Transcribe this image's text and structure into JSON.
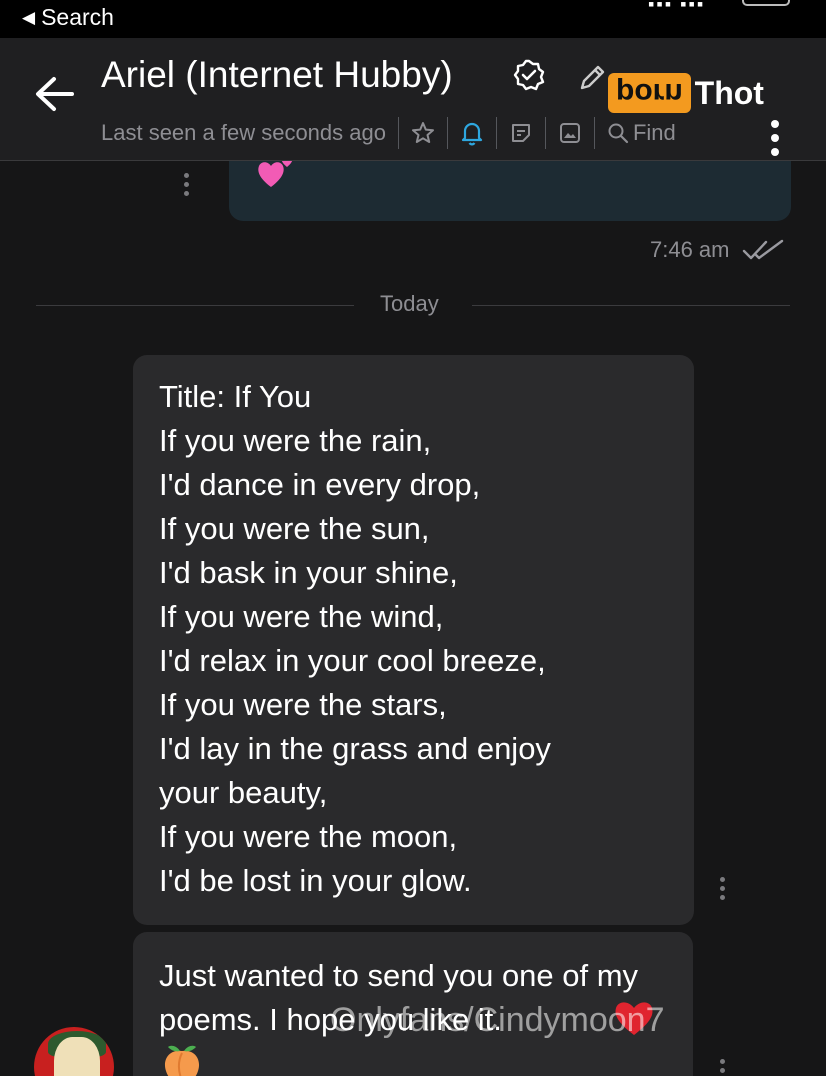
{
  "status_bar": {
    "back_label": "Search",
    "back_icon": "back-triangle-icon"
  },
  "header": {
    "title": "Ariel (Internet Hubby)",
    "last_seen": "Last seen a few seconds ago",
    "find_label": "Find",
    "brand": {
      "part_a": "porn",
      "part_b": "Thot"
    },
    "icons": [
      "back-arrow-icon",
      "verified-badge-icon",
      "pencil-icon",
      "star-icon",
      "bell-icon",
      "sticker-icon",
      "image-icon",
      "search-icon",
      "more-menu-icon"
    ],
    "colors": {
      "accent_bell": "#2ea7e0",
      "brand_orange": "#f39a1f"
    }
  },
  "chat": {
    "previous_message": {
      "emoji": "💕",
      "time": "7:46 am",
      "status": "read"
    },
    "date_divider": "Today",
    "poem_lines": [
      "Title: If You",
      "If you were the rain,",
      "I'd dance in every drop,",
      "If you were the sun,",
      "I'd bask in your shine,",
      "If you were the wind,",
      "I'd relax in your cool breeze,",
      "If you were the stars,",
      "I'd lay in the grass and enjoy",
      "your beauty,",
      "If you were the moon,",
      "I'd be lost in your glow."
    ],
    "second_message": "Just wanted to send you one of my poems. I hope you like it.",
    "watermark": "Onlyfans/Cindymoon7",
    "emojis": [
      "❤️",
      "🍑"
    ]
  }
}
